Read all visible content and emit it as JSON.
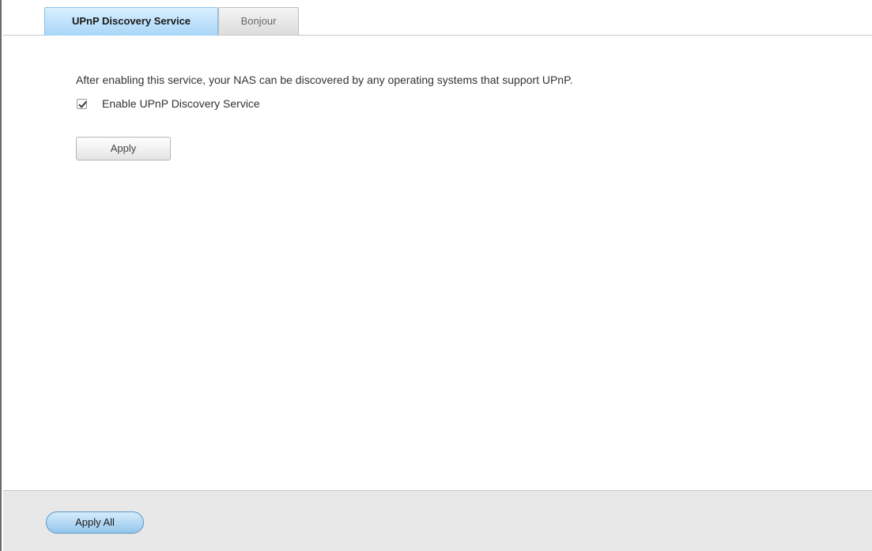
{
  "tabs": [
    {
      "label": "UPnP Discovery Service",
      "active": true
    },
    {
      "label": "Bonjour",
      "active": false
    }
  ],
  "upnp": {
    "description": "After enabling this service, your NAS can be discovered by any operating systems that support UPnP.",
    "enable_label": "Enable UPnP Discovery Service",
    "enable_checked": true,
    "apply_label": "Apply"
  },
  "footer": {
    "apply_all_label": "Apply All"
  },
  "colors": {
    "active_tab": "#a8d6f7",
    "apply_all_button": "#93c6ec"
  }
}
